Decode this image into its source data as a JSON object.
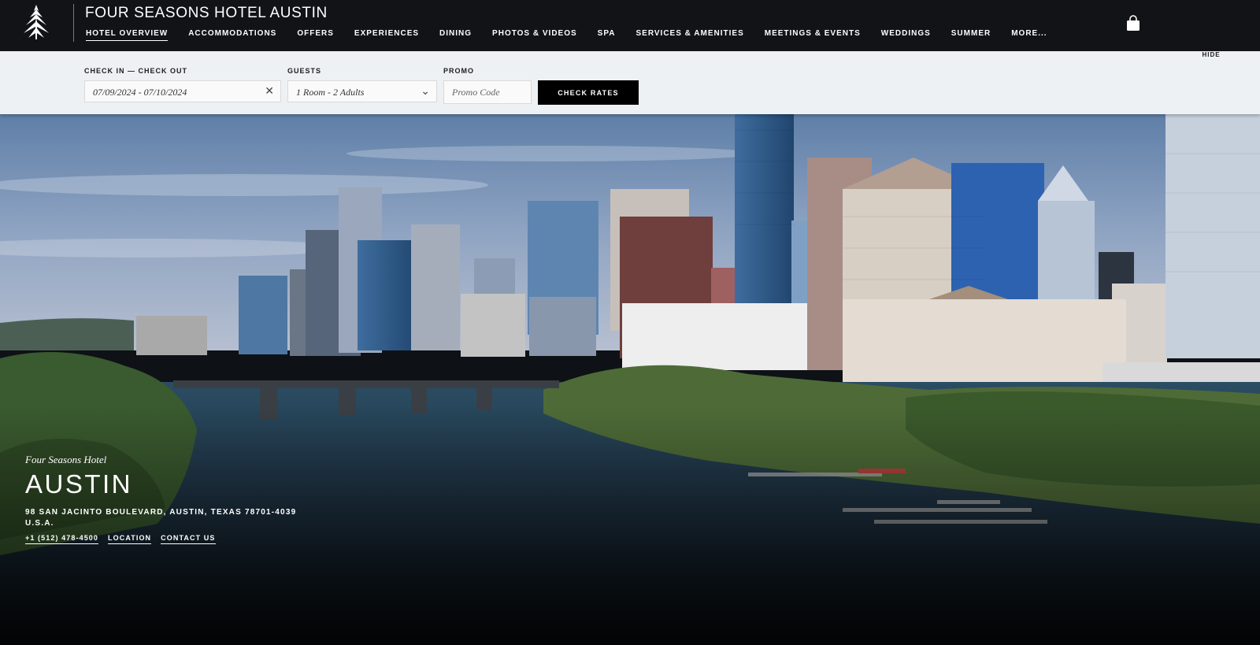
{
  "brand": {
    "hotel_name": "FOUR SEASONS HOTEL AUSTIN",
    "logo_icon": "four-seasons-tree-icon"
  },
  "nav": {
    "items": [
      {
        "label": "HOTEL OVERVIEW",
        "active": true
      },
      {
        "label": "ACCOMMODATIONS",
        "active": false
      },
      {
        "label": "OFFERS",
        "active": false
      },
      {
        "label": "EXPERIENCES",
        "active": false
      },
      {
        "label": "DINING",
        "active": false
      },
      {
        "label": "PHOTOS & VIDEOS",
        "active": false
      },
      {
        "label": "SPA",
        "active": false
      },
      {
        "label": "SERVICES & AMENITIES",
        "active": false
      },
      {
        "label": "MEETINGS & EVENTS",
        "active": false
      },
      {
        "label": "WEDDINGS",
        "active": false
      },
      {
        "label": "SUMMER",
        "active": false
      },
      {
        "label": "MORE...",
        "active": false
      }
    ],
    "bag_icon": "shopping-bag-icon"
  },
  "booking": {
    "dates_label": "CHECK IN — CHECK OUT",
    "dates_value": "07/09/2024 - 07/10/2024",
    "guests_label": "GUESTS",
    "guests_value": "1 Room - 2 Adults",
    "promo_label": "PROMO",
    "promo_placeholder": "Promo Code",
    "check_rates_label": "CHECK RATES",
    "hide_label": "HIDE"
  },
  "hero": {
    "eyebrow": "Four Seasons Hotel",
    "city": "AUSTIN",
    "address": "98 SAN JACINTO BOULEVARD, AUSTIN, TEXAS 78701-4039",
    "country": "U.S.A.",
    "phone": "+1 (512) 478-4500",
    "location_link": "LOCATION",
    "contact_link": "CONTACT US"
  },
  "colors": {
    "nav_bg": "#121317",
    "booking_bg": "#eef1f4",
    "button_bg": "#000000"
  }
}
